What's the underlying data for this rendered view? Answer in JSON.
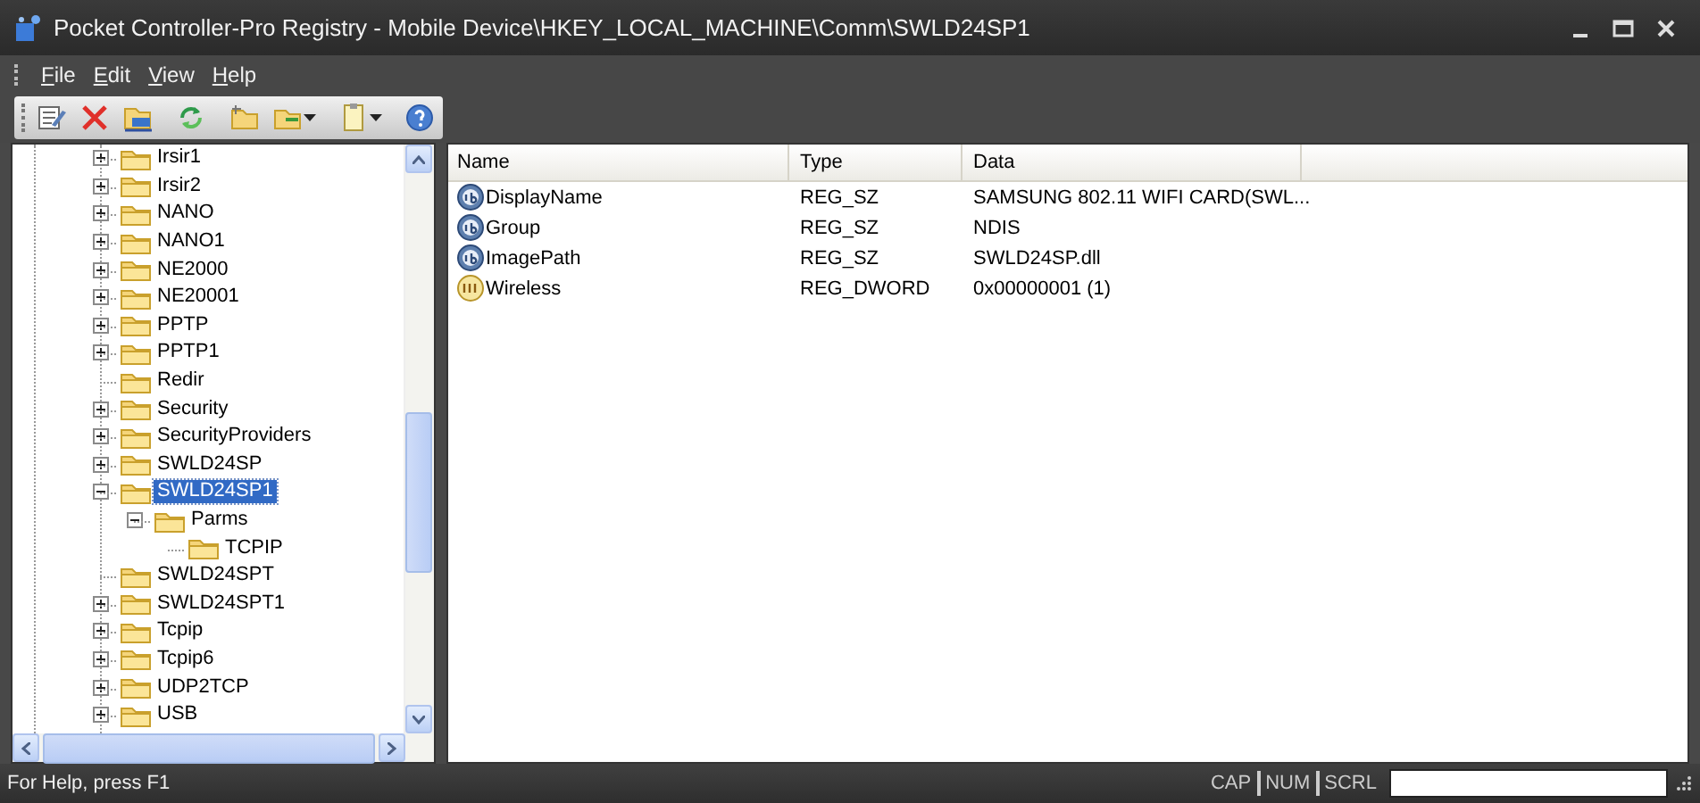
{
  "window": {
    "title": "Pocket Controller-Pro Registry - Mobile Device\\HKEY_LOCAL_MACHINE\\Comm\\SWLD24SP1"
  },
  "menu": [
    {
      "label": "File"
    },
    {
      "label": "Edit"
    },
    {
      "label": "View"
    },
    {
      "label": "Help"
    }
  ],
  "toolbar": [
    {
      "kind": "properties",
      "dropdown": false
    },
    {
      "kind": "delete",
      "dropdown": false
    },
    {
      "kind": "export",
      "dropdown": false
    },
    {
      "kind": "refresh",
      "dropdown": false
    },
    {
      "kind": "new-key",
      "dropdown": false
    },
    {
      "kind": "new-value",
      "dropdown": true
    },
    {
      "kind": "clipboard",
      "dropdown": true
    },
    {
      "kind": "help",
      "dropdown": false
    }
  ],
  "tree": {
    "items": [
      {
        "label": "Irsir1",
        "kind": "node",
        "expanded": false,
        "selected": false
      },
      {
        "label": "Irsir2",
        "kind": "node",
        "expanded": false,
        "selected": false
      },
      {
        "label": "NANO",
        "kind": "node",
        "expanded": false,
        "selected": false
      },
      {
        "label": "NANO1",
        "kind": "node",
        "expanded": false,
        "selected": false
      },
      {
        "label": "NE2000",
        "kind": "node",
        "expanded": false,
        "selected": false
      },
      {
        "label": "NE20001",
        "kind": "node",
        "expanded": false,
        "selected": false
      },
      {
        "label": "PPTP",
        "kind": "node",
        "expanded": false,
        "selected": false
      },
      {
        "label": "PPTP1",
        "kind": "node",
        "expanded": false,
        "selected": false
      },
      {
        "label": "Redir",
        "kind": "leaf",
        "selected": false
      },
      {
        "label": "Security",
        "kind": "node",
        "expanded": false,
        "selected": false
      },
      {
        "label": "SecurityProviders",
        "kind": "node",
        "expanded": false,
        "selected": false
      },
      {
        "label": "SWLD24SP",
        "kind": "node",
        "expanded": false,
        "selected": false
      },
      {
        "label": "SWLD24SP1",
        "kind": "node",
        "expanded": true,
        "selected": true,
        "children": [
          {
            "label": "Parms",
            "kind": "node",
            "expanded": true,
            "selected": false,
            "children": [
              {
                "label": "TCPIP",
                "kind": "leaf",
                "selected": false
              }
            ]
          }
        ]
      },
      {
        "label": "SWLD24SPT",
        "kind": "leaf",
        "selected": false
      },
      {
        "label": "SWLD24SPT1",
        "kind": "node",
        "expanded": false,
        "selected": false
      },
      {
        "label": "Tcpip",
        "kind": "node",
        "expanded": false,
        "selected": false
      },
      {
        "label": "Tcpip6",
        "kind": "node",
        "expanded": false,
        "selected": false
      },
      {
        "label": "UDP2TCP",
        "kind": "node",
        "expanded": false,
        "selected": false
      },
      {
        "label": "USB",
        "kind": "node",
        "expanded": false,
        "selected": false
      }
    ]
  },
  "values": {
    "columns": [
      "Name",
      "Type",
      "Data"
    ],
    "rows": [
      {
        "kind": "string",
        "name": "DisplayName",
        "type": "REG_SZ",
        "data": "SAMSUNG 802.11 WIFI CARD(SWL..."
      },
      {
        "kind": "string",
        "name": "Group",
        "type": "REG_SZ",
        "data": "NDIS"
      },
      {
        "kind": "string",
        "name": "ImagePath",
        "type": "REG_SZ",
        "data": "SWLD24SP.dll"
      },
      {
        "kind": "dword",
        "name": "Wireless",
        "type": "REG_DWORD",
        "data": "0x00000001 (1)"
      }
    ]
  },
  "status_bar": {
    "text": "For Help, press F1",
    "indicators": [
      "CAP",
      "NUM",
      "SCRL"
    ]
  }
}
